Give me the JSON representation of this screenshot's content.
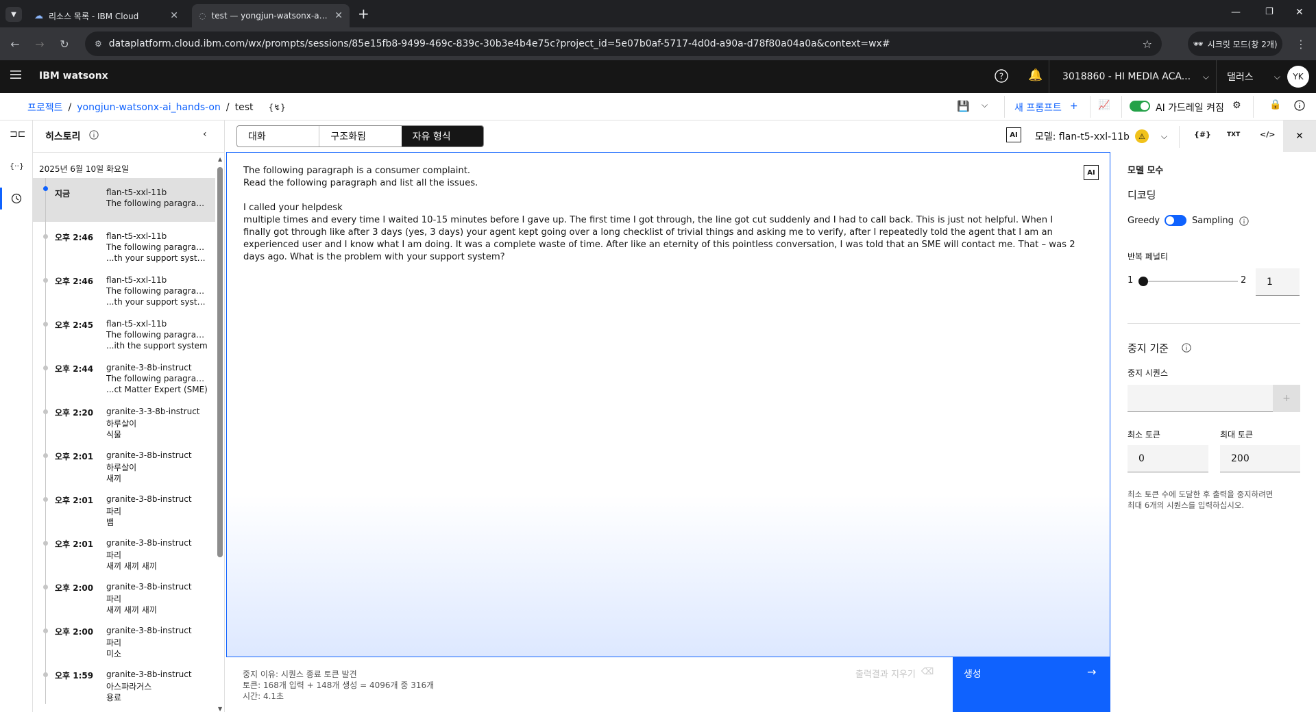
{
  "browser": {
    "tabs": [
      {
        "title": "리소스 목록 - IBM Cloud",
        "active": false
      },
      {
        "title": "test — yongjun-watsonx-ai_hands-on",
        "active": true
      }
    ],
    "url": "dataplatform.cloud.ibm.com/wx/prompts/sessions/85e15fb8-9499-469c-839c-30b3e4b4e75c?project_id=5e07b0af-5717-4d0d-a90a-d78f80a04a0a&context=wx#",
    "incognito_label": "시크릿 모드(창 2개)"
  },
  "header": {
    "brand": "IBM watsonx",
    "account": "3018860 - HI MEDIA ACA...",
    "region": "댈러스",
    "avatar": "YK"
  },
  "breadcrumb": {
    "items": [
      "프로젝트",
      "yongjun-watsonx-ai_hands-on",
      "test"
    ],
    "separator": "/"
  },
  "toolbar": {
    "new_prompt": "새 프롬프트",
    "guardrail_label": "AI 가드레일 켜짐",
    "model_label": "모델: flan-t5-xxl-11b",
    "ai_badge": "AI",
    "txt_label": "TXT"
  },
  "history": {
    "title": "히스토리",
    "date": "2025년 6월 10일 화요일",
    "items": [
      {
        "time": "지금",
        "model": "flan-t5-xxl-11b",
        "line2": "The following paragrap...",
        "line3": ""
      },
      {
        "time": "오후 2:46",
        "model": "flan-t5-xxl-11b",
        "line2": "The following paragrap...",
        "line3": "...th your support system"
      },
      {
        "time": "오후 2:46",
        "model": "flan-t5-xxl-11b",
        "line2": "The following paragrap...",
        "line3": "...th your support system"
      },
      {
        "time": "오후 2:45",
        "model": "flan-t5-xxl-11b",
        "line2": "The following paragrap...",
        "line3": "...ith the support system"
      },
      {
        "time": "오후 2:44",
        "model": "granite-3-8b-instruct",
        "line2": "The following paragrap...",
        "line3": "...ct Matter Expert (SME)"
      },
      {
        "time": "오후 2:20",
        "model": "granite-3-3-8b-instruct",
        "line2": "하루살이",
        "line3": "식물"
      },
      {
        "time": "오후 2:01",
        "model": "granite-3-8b-instruct",
        "line2": "하루살이",
        "line3": "새끼"
      },
      {
        "time": "오후 2:01",
        "model": "granite-3-8b-instruct",
        "line2": "파리",
        "line3": "뱀"
      },
      {
        "time": "오후 2:01",
        "model": "granite-3-8b-instruct",
        "line2": "파리",
        "line3": "새끼 새끼 새끼"
      },
      {
        "time": "오후 2:00",
        "model": "granite-3-8b-instruct",
        "line2": "파리",
        "line3": "새끼 새끼 새끼"
      },
      {
        "time": "오후 2:00",
        "model": "granite-3-8b-instruct",
        "line2": "파리",
        "line3": "미소"
      },
      {
        "time": "오후 1:59",
        "model": "granite-3-8b-instruct",
        "line2": "아스파라거스",
        "line3": "용료"
      }
    ]
  },
  "editor": {
    "modes": [
      "대화",
      "구조화됨",
      "자유 형식"
    ],
    "selected_mode": "자유 형식",
    "ai_badge": "AI",
    "prompt_text": "The following paragraph is a consumer complaint.\nRead the following paragraph and list all the issues.\n\nI called your helpdesk\nmultiple times and every time I waited 10-15 minutes before I gave up. The first time I got through, the line got cut suddenly and I had to call back. This is just not helpful. When I finally got through like after 3 days (yes, 3 days) your agent kept going over a long checklist of trivial things and asking me to verify, after I repeatedly told the agent that I am an experienced user and I know what I am doing. It was a complete waste of time. After like an eternity of this pointless conversation, I was told that an SME will contact me. That – was 2 days ago. What is the problem with your support system?"
  },
  "footer": {
    "stop_reason": "중지 이유: 시퀀스 종료 토큰 발견",
    "tokens": "토큰: 168개 입력 + 148개 생성 = 4096개 중 316개",
    "time": "시간: 4.1초",
    "clear_label": "출력결과 지우기",
    "generate_label": "생성"
  },
  "params": {
    "title": "모델 모수",
    "decoding_title": "디코딩",
    "greedy": "Greedy",
    "sampling": "Sampling",
    "repetition_title": "반복 페널티",
    "rep_min": "1",
    "rep_max": "2",
    "rep_value": "1",
    "stop_title": "중지 기준",
    "stop_seq_label": "중지 시퀀스",
    "stop_seq_value": "",
    "add_symbol": "+",
    "min_tokens_label": "최소 토큰",
    "min_tokens": "0",
    "max_tokens_label": "최대 토큰",
    "max_tokens": "200",
    "helper_line1": "최소 토큰 수에 도달한 후 출력을 중지하려면",
    "helper_line2": "최대 6개의 시퀀스를 입력하십시오."
  },
  "colors": {
    "accent": "#0f62fe",
    "toggle_on": "#24a148",
    "warning": "#f1c21b"
  }
}
